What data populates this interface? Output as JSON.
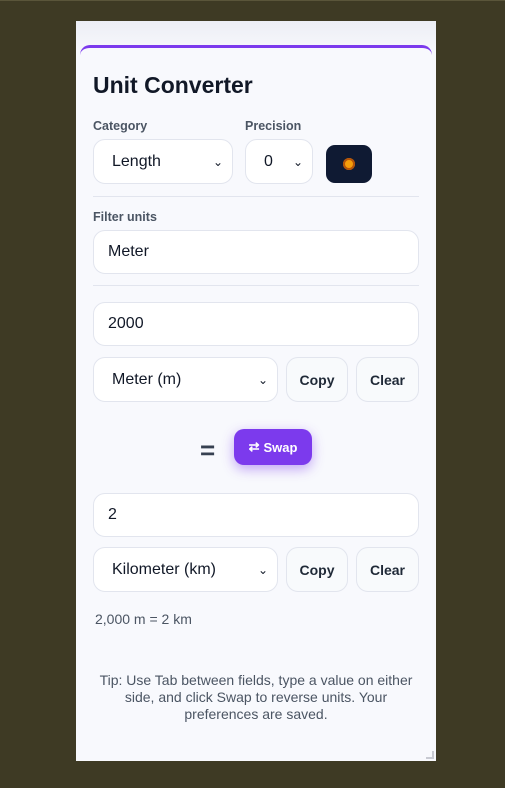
{
  "app": {
    "title": "Unit Converter"
  },
  "controls": {
    "category_label": "Category",
    "category_value": "Length",
    "precision_label": "Precision",
    "precision_value": "0",
    "theme_icon": "sun-icon"
  },
  "filter": {
    "label": "Filter units",
    "value": "Meter"
  },
  "from": {
    "value": "2000",
    "unit": "Meter (m)",
    "copy_label": "Copy",
    "clear_label": "Clear"
  },
  "middle": {
    "equals": "=",
    "swap_icon": "⇄",
    "swap_label": "Swap"
  },
  "to": {
    "value": "2",
    "unit": "Kilometer (km)",
    "copy_label": "Copy",
    "clear_label": "Clear"
  },
  "result": "2,000 m = 2 km",
  "tip": "Tip: Use Tab between fields, type a value on either side, and click Swap to reverse units. Your preferences are saved.",
  "colors": {
    "accent": "#7c3aed",
    "page_bg": "#3e3a24",
    "theme_button": "#0f1a33"
  }
}
